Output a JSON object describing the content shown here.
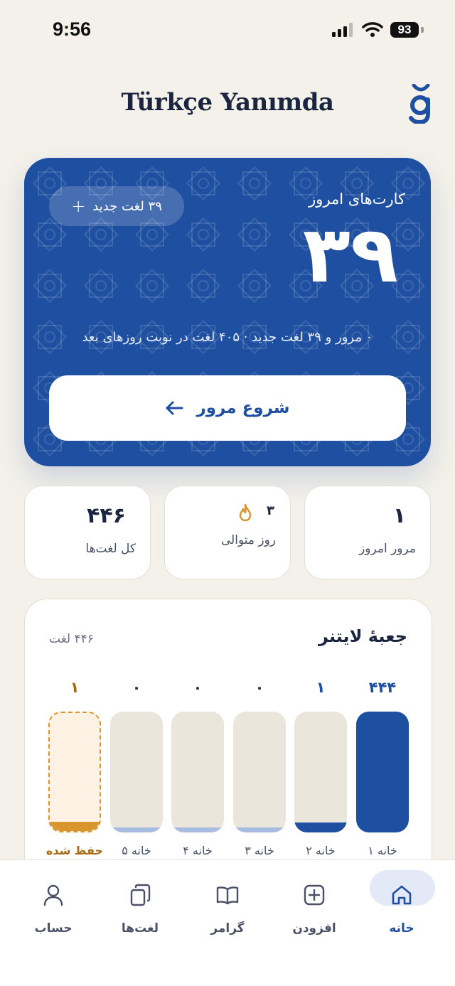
{
  "status_bar": {
    "time": "9:56",
    "battery": "93"
  },
  "header": {
    "title": "Türkçe Yanımda",
    "logo_icon": "g-breve-logo"
  },
  "hero": {
    "label": "کارت‌های امروز",
    "count": "۳۹",
    "new_pill": "۳۹ لغت جدید",
    "summary": "۰ مرور و ۳۹ لغت جدید · ۴۰۵ لغت در نوبت روزهای بعد",
    "start_button": "شروع مرور",
    "colors": {
      "background": "#1f4fa0"
    }
  },
  "stats": [
    {
      "value": "۱",
      "label": "مرور امروز"
    },
    {
      "value": "۳",
      "label": "روز متوالی",
      "icon": "flame-icon"
    },
    {
      "value": "۴۴۶",
      "label": "کل لغت‌ها"
    }
  ],
  "leitner": {
    "title": "جعبهٔ لایتنر",
    "total": "۴۴۶ لغت",
    "boxes": [
      {
        "label": "خانه ۱",
        "count": "۴۴۴",
        "fill": 1.0,
        "color": "#1f4fa0"
      },
      {
        "label": "خانه ۲",
        "count": "۱",
        "fill": 0.08,
        "color": "#1f4fa0"
      },
      {
        "label": "خانه ۳",
        "count": "۰",
        "fill": 0.04,
        "color": "#a8bcdf"
      },
      {
        "label": "خانه ۴",
        "count": "۰",
        "fill": 0.04,
        "color": "#a8bcdf"
      },
      {
        "label": "خانه ۵",
        "count": "۰",
        "fill": 0.04,
        "color": "#a8bcdf"
      },
      {
        "label": "حفظ شده",
        "count": "۱",
        "fill": 0.08,
        "color": "#d9952e"
      }
    ]
  },
  "nav": [
    {
      "label": "خانه",
      "icon": "home-icon",
      "active": true
    },
    {
      "label": "افزودن",
      "icon": "add-icon"
    },
    {
      "label": "گرامر",
      "icon": "book-icon"
    },
    {
      "label": "لغت‌ها",
      "icon": "cards-icon"
    },
    {
      "label": "حساب",
      "icon": "person-icon"
    }
  ]
}
